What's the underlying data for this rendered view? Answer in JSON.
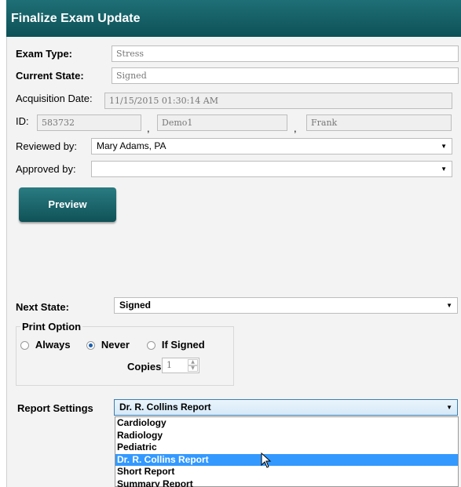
{
  "header": {
    "title": "Finalize Exam Update"
  },
  "exam_type": {
    "label": "Exam Type:",
    "value": "Stress"
  },
  "current_state": {
    "label": "Current State:",
    "value": "Signed"
  },
  "acquisition_date": {
    "label": "Acquisition Date:",
    "value": "11/15/2015 01:30:14 AM"
  },
  "patient_id": {
    "label": "ID:",
    "id_value": "583732",
    "separator": ",",
    "last_name": "Demo1",
    "first_name": "Frank"
  },
  "reviewed_by": {
    "label": "Reviewed by:",
    "value": "Mary Adams, PA"
  },
  "approved_by": {
    "label": "Approved by:",
    "value": ""
  },
  "preview_button": {
    "label": "Preview"
  },
  "next_state": {
    "label": "Next State:",
    "value": "Signed"
  },
  "print_option": {
    "legend": "Print Option",
    "options": [
      "Always",
      "Never",
      "If Signed"
    ],
    "selected": "Never",
    "copies_label": "Copies",
    "copies_value": "1"
  },
  "report_settings": {
    "label": "Report Settings",
    "value": "Dr. R. Collins Report",
    "options": [
      "Cardiology",
      "Radiology",
      "Pediatric",
      "Dr. R. Collins Report",
      "Short Report",
      "Summary Report"
    ],
    "highlighted": "Dr. R. Collins Report"
  },
  "colors": {
    "header": "#0d5157",
    "selection": "#3399ff",
    "combo_focus_border": "#3c7fb1"
  }
}
